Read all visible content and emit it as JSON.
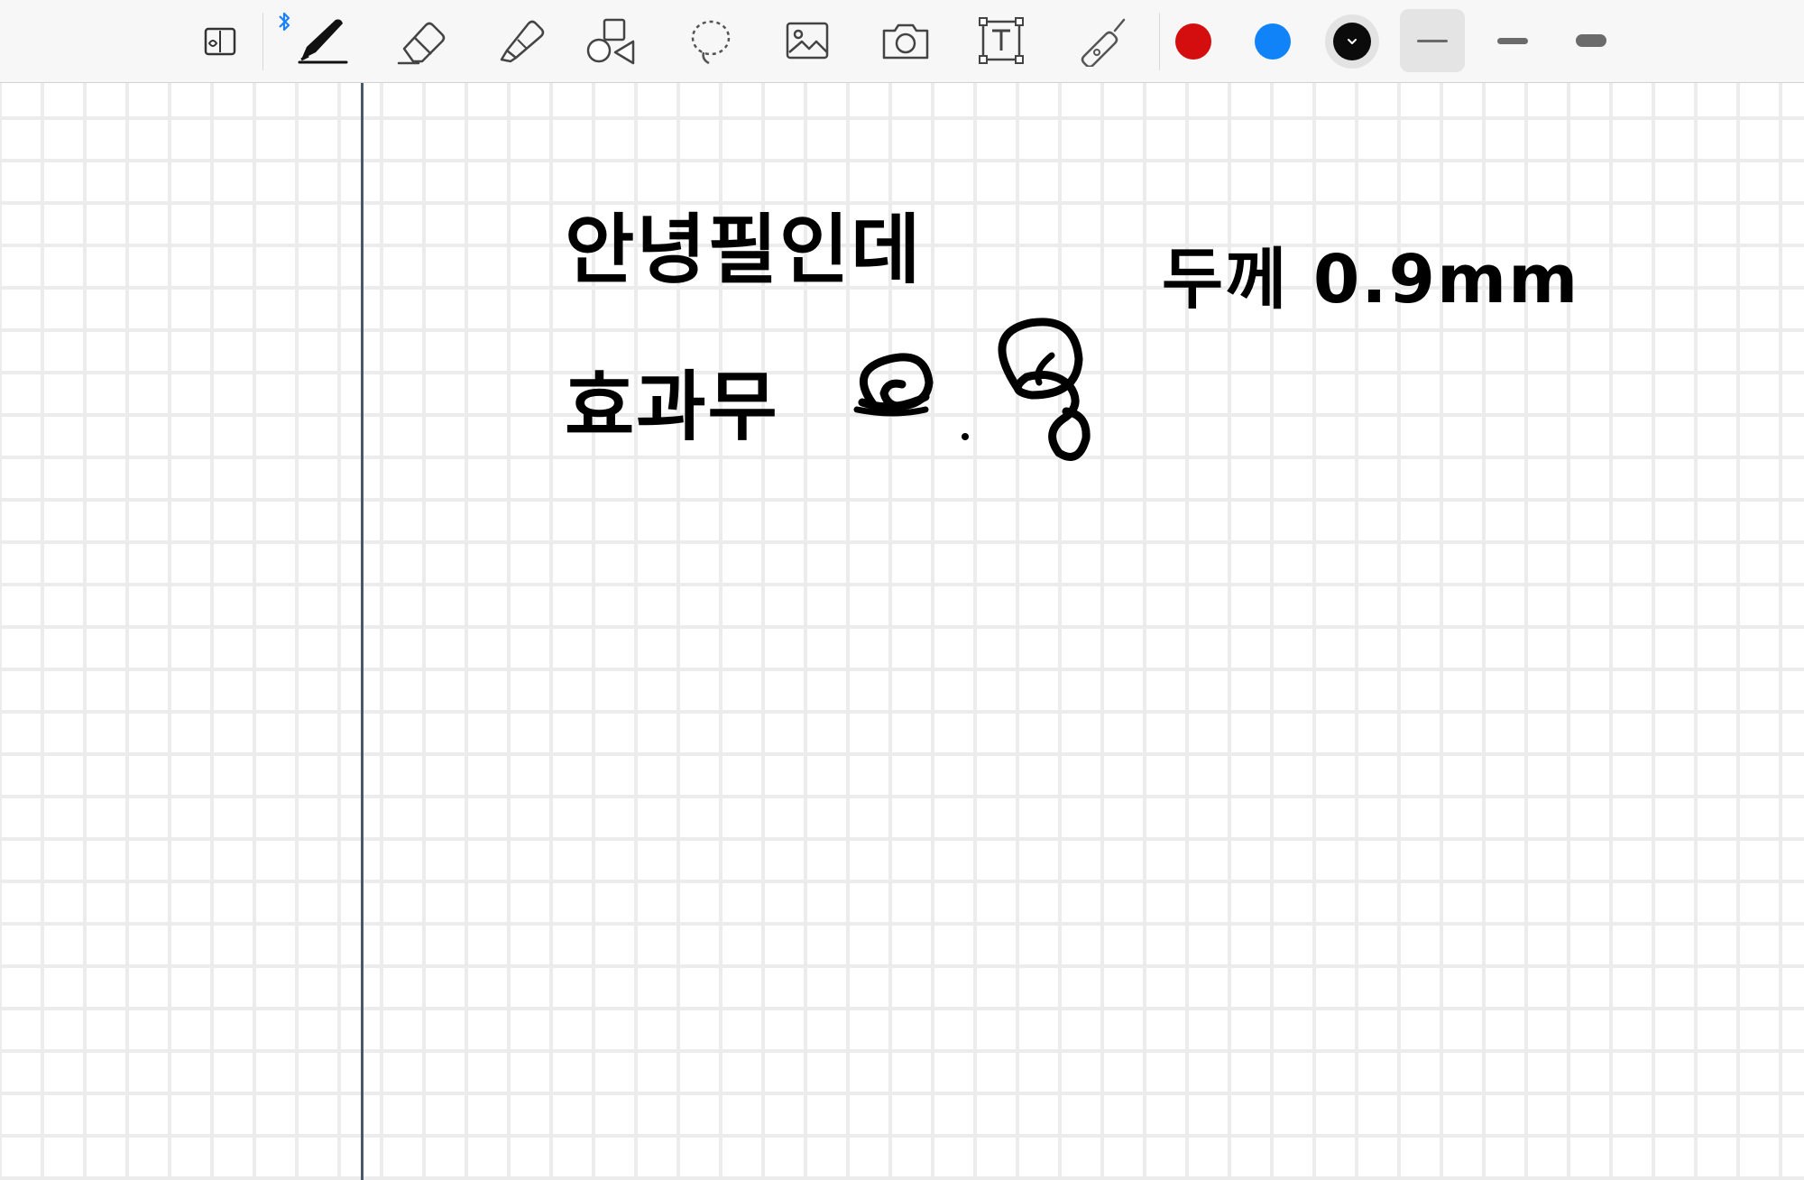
{
  "toolbar": {
    "tools": [
      {
        "name": "page-view-toggle",
        "icon": "page-toggle-icon"
      },
      {
        "name": "pen",
        "icon": "pen-icon",
        "selected": true
      },
      {
        "name": "eraser",
        "icon": "eraser-icon"
      },
      {
        "name": "highlighter",
        "icon": "highlighter-icon"
      },
      {
        "name": "shapes",
        "icon": "shapes-icon"
      },
      {
        "name": "lasso",
        "icon": "lasso-icon"
      },
      {
        "name": "image",
        "icon": "image-icon"
      },
      {
        "name": "camera",
        "icon": "camera-icon"
      },
      {
        "name": "text",
        "icon": "text-box-icon"
      },
      {
        "name": "laser-pointer",
        "icon": "laser-pointer-icon"
      }
    ],
    "bluetooth_icon": "bluetooth-icon",
    "colors": [
      {
        "name": "red",
        "hex": "#d40e0e"
      },
      {
        "name": "blue",
        "hex": "#0f83f7"
      },
      {
        "name": "black",
        "hex": "#0b0b0b",
        "selected": true
      }
    ],
    "thickness_options": [
      {
        "name": "thin",
        "selected": true
      },
      {
        "name": "medium"
      },
      {
        "name": "thick"
      }
    ]
  },
  "canvas": {
    "paper": "grid",
    "handwriting": {
      "line1": "안녕필인데",
      "line2": "효과무",
      "line2_drawing": "doodle",
      "note": "두께 0.9mm"
    },
    "ink_color": "#000000"
  }
}
